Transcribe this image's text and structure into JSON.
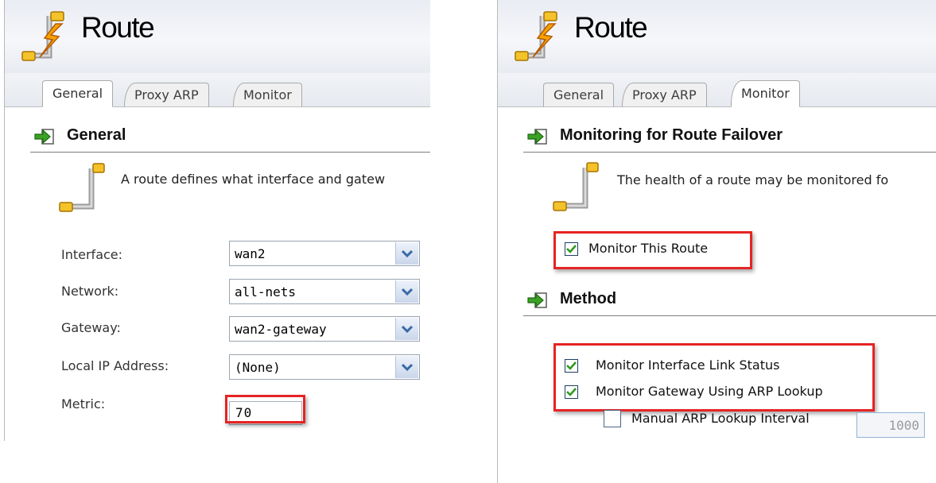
{
  "left_panel": {
    "title": "Route",
    "tabs": [
      {
        "label": "General",
        "active": true
      },
      {
        "label": "Proxy ARP",
        "active": false
      },
      {
        "label": "Monitor",
        "active": false
      }
    ],
    "section": {
      "title": "General"
    },
    "info_text": "A route defines what interface and gatew",
    "fields": {
      "interface": {
        "label": "Interface:",
        "value": "wan2"
      },
      "network": {
        "label": "Network:",
        "value": "all-nets"
      },
      "gateway": {
        "label": "Gateway:",
        "value": "wan2-gateway"
      },
      "local_ip": {
        "label": "Local IP Address:",
        "value": "(None)"
      },
      "metric": {
        "label": "Metric:",
        "value": "70"
      }
    }
  },
  "right_panel": {
    "title": "Route",
    "tabs": [
      {
        "label": "General",
        "active": false
      },
      {
        "label": "Proxy ARP",
        "active": false
      },
      {
        "label": "Monitor",
        "active": true
      }
    ],
    "section_monitoring": {
      "title": "Monitoring for Route Failover"
    },
    "info_text": "The health of a route may be monitored fo",
    "monitor_route": {
      "label": "Monitor This Route",
      "checked": true
    },
    "section_method": {
      "title": "Method"
    },
    "monitor_link": {
      "label": "Monitor Interface Link Status",
      "checked": true
    },
    "monitor_arp": {
      "label": "Monitor Gateway Using ARP Lookup",
      "checked": true
    },
    "manual_arp": {
      "label": "Manual ARP Lookup Interval",
      "checked": false,
      "value": "1000"
    }
  },
  "colors": {
    "highlight_box": "#e62424",
    "checkmark": "#2f9a1e",
    "dropdown_arrow": "#3a6aa8"
  }
}
